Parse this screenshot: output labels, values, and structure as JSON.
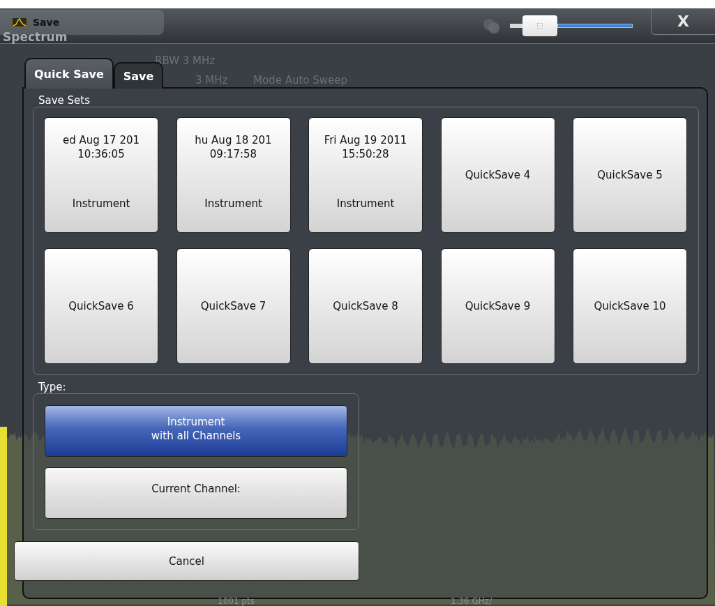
{
  "window": {
    "title": "Save",
    "zoom_slider": {
      "level": 0.1
    },
    "close": "X"
  },
  "background_labels": [
    {
      "text": "Spectrum"
    },
    {
      "text": "RBW  3 MHz"
    },
    {
      "text": "3 MHz"
    },
    {
      "text": "Mode  Auto Sweep"
    },
    {
      "text": "1001 pts"
    },
    {
      "text": "1.36 GHz/"
    }
  ],
  "tabs": [
    {
      "label": "Quick Save",
      "selected": true
    },
    {
      "label": "Save",
      "selected": false
    }
  ],
  "save_sets": {
    "title": "Save Sets",
    "slots": [
      {
        "kind": "saved",
        "date": "ed Aug 17 201",
        "time": "10:36:05",
        "type": "Instrument"
      },
      {
        "kind": "saved",
        "date": "hu Aug 18 201",
        "time": "09:17:58",
        "type": "Instrument"
      },
      {
        "kind": "saved",
        "date": "Fri Aug 19 2011",
        "time": "15:50:28",
        "type": "Instrument"
      },
      {
        "kind": "empty",
        "label": "QuickSave 4"
      },
      {
        "kind": "empty",
        "label": "QuickSave 5"
      },
      {
        "kind": "empty",
        "label": "QuickSave 6"
      },
      {
        "kind": "empty",
        "label": "QuickSave 7"
      },
      {
        "kind": "empty",
        "label": "QuickSave 8"
      },
      {
        "kind": "empty",
        "label": "QuickSave 9"
      },
      {
        "kind": "empty",
        "label": "QuickSave 10"
      }
    ]
  },
  "type_group": {
    "title": "Type:",
    "options": [
      {
        "label": "Instrument\nwith all Channels",
        "selected": true
      },
      {
        "label": "Current Channel:",
        "selected": false
      }
    ]
  },
  "cancel": "Cancel"
}
